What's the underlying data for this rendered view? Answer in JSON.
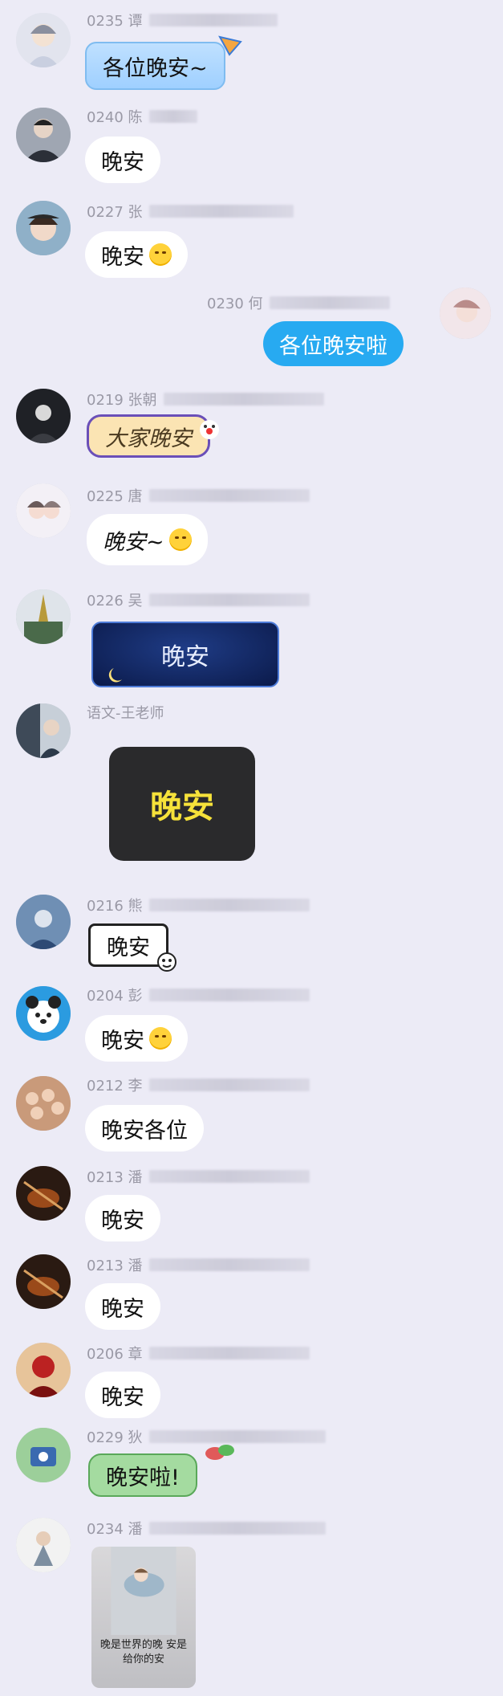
{
  "colors": {
    "background": "#ecebf6",
    "bubble_in": "#ffffff",
    "bubble_out": "#27aaf1",
    "name_text": "#9a99a6"
  },
  "messages": [
    {
      "id": "m1",
      "sender": "0235 谭",
      "text": "各位晚安~",
      "style": "blue-theme-bubble"
    },
    {
      "id": "m2",
      "sender": "0240 陈",
      "text": "晚安",
      "style": "plain"
    },
    {
      "id": "m3",
      "sender": "0227 张",
      "text": "晚安",
      "emoji": "sleepy-face-icon",
      "style": "plain"
    },
    {
      "id": "m4",
      "sender": "0230 何",
      "text": "各位晚安啦",
      "style": "self"
    },
    {
      "id": "m5",
      "sender": "0219 张朝",
      "text": "大家晚安",
      "style": "clown-theme-bubble"
    },
    {
      "id": "m6",
      "sender": "0225 唐",
      "text": "晚安~",
      "emoji": "smile-face-icon",
      "style": "handwritten"
    },
    {
      "id": "m7",
      "sender": "0226 吴",
      "text": "晚安",
      "style": "night-sky-bubble"
    },
    {
      "id": "m8",
      "sender": "语文-王老师",
      "text": "晚安",
      "style": "dark-sticker"
    },
    {
      "id": "m9",
      "sender": "0216 熊",
      "text": "晚安",
      "style": "comic-bubble"
    },
    {
      "id": "m10",
      "sender": "0204 彭",
      "text": "晚安",
      "emoji": "smile-face-icon",
      "style": "plain"
    },
    {
      "id": "m11",
      "sender": "0212 李",
      "text": "晚安各位",
      "style": "plain"
    },
    {
      "id": "m12",
      "sender": "0213 潘",
      "text": "晚安",
      "style": "plain"
    },
    {
      "id": "m13",
      "sender": "0213 潘",
      "text": "晚安",
      "style": "plain"
    },
    {
      "id": "m14",
      "sender": "0206 章",
      "text": "晚安",
      "style": "plain"
    },
    {
      "id": "m15",
      "sender": "0229 狄",
      "text": "晚安啦!",
      "style": "green-theme-bubble"
    },
    {
      "id": "m16",
      "sender": "0234 潘",
      "text": "",
      "style": "photo"
    }
  ],
  "photo_caption": "晚是世界的晚 安是给你的安"
}
